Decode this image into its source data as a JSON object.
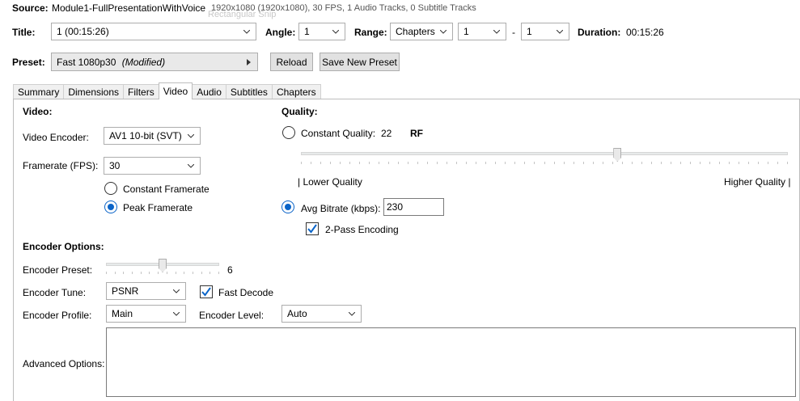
{
  "source": {
    "label": "Source:",
    "name": "Module1-FullPresentationWithVoice",
    "info": "1920x1080 (1920x1080), 30 FPS, 1 Audio Tracks, 0 Subtitle Tracks",
    "ghost": "Rectangular Snip"
  },
  "title_row": {
    "title_label": "Title:",
    "title_value": "1 (00:15:26)",
    "angle_label": "Angle:",
    "angle_value": "1",
    "range_label": "Range:",
    "range_type": "Chapters",
    "range_start": "1",
    "range_sep": "-",
    "range_end": "1",
    "duration_label": "Duration:",
    "duration_value": "00:15:26"
  },
  "preset_row": {
    "label": "Preset:",
    "name": "Fast 1080p30",
    "modified": "(Modified)",
    "reload": "Reload",
    "save_new": "Save New Preset"
  },
  "tabs": [
    {
      "label": "Summary"
    },
    {
      "label": "Dimensions"
    },
    {
      "label": "Filters"
    },
    {
      "label": "Video"
    },
    {
      "label": "Audio"
    },
    {
      "label": "Subtitles"
    },
    {
      "label": "Chapters"
    }
  ],
  "active_tab": "Video",
  "video": {
    "heading": "Video:",
    "encoder_label": "Video Encoder:",
    "encoder_value": "AV1 10-bit (SVT)",
    "framerate_label": "Framerate (FPS):",
    "framerate_value": "30",
    "constant_framerate": "Constant Framerate",
    "peak_framerate": "Peak Framerate",
    "peak_selected": true
  },
  "quality": {
    "heading": "Quality:",
    "constant_quality_label": "Constant Quality:",
    "cq_value": "22",
    "cq_unit": "RF",
    "cq_selected": false,
    "slider_fraction": 0.65,
    "lower": "| Lower Quality",
    "higher": "Higher Quality |",
    "avg_bitrate_label": "Avg Bitrate (kbps):",
    "avg_bitrate_value": "230",
    "avg_selected": true,
    "two_pass_label": "2-Pass Encoding",
    "two_pass_checked": true
  },
  "encoder_options": {
    "heading": "Encoder Options:",
    "preset_label": "Encoder Preset:",
    "preset_value": "6",
    "preset_fraction": 0.5,
    "tune_label": "Encoder Tune:",
    "tune_value": "PSNR",
    "fast_decode_label": "Fast Decode",
    "fast_decode_checked": true,
    "profile_label": "Encoder Profile:",
    "profile_value": "Main",
    "level_label": "Encoder Level:",
    "level_value": "Auto",
    "advanced_label": "Advanced Options:",
    "advanced_value": ""
  },
  "colors": {
    "accent": "#0a64c8",
    "border": "#adadad",
    "button_bg": "#e1e1e1"
  }
}
